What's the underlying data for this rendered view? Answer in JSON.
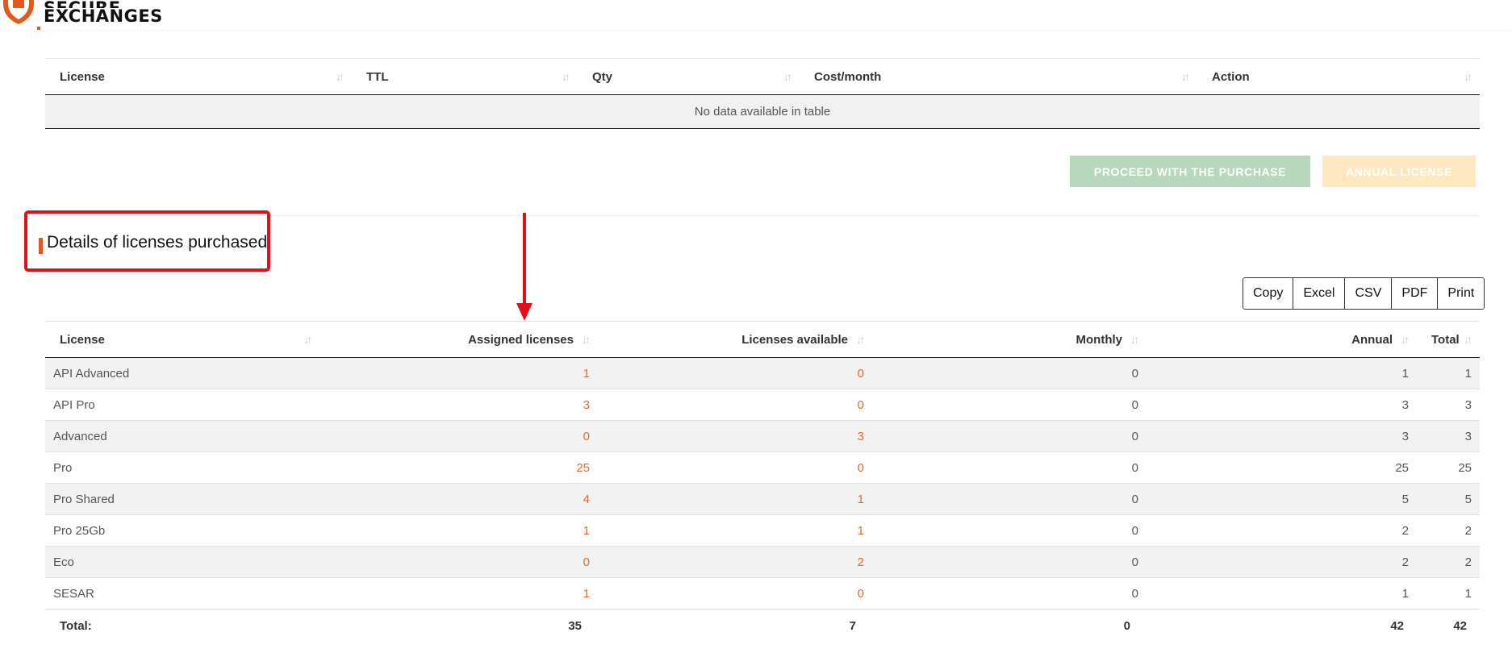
{
  "brand": {
    "line1": "SECURE",
    "line2": "EXCHANGES",
    "accent_color": "#e05a1e"
  },
  "cart_table": {
    "columns": [
      "License",
      "TTL",
      "Qty",
      "Cost/month",
      "Action"
    ],
    "empty_message": "No data available in table"
  },
  "buttons": {
    "purchase": "PROCEED WITH THE PURCHASE",
    "annual": "ANNUAL LICENSE"
  },
  "details": {
    "title": "Details of licenses purchased",
    "export_buttons": [
      "Copy",
      "Excel",
      "CSV",
      "PDF",
      "Print"
    ],
    "columns": [
      "License",
      "Assigned licenses",
      "Licenses available",
      "Monthly",
      "Annual",
      "Total"
    ],
    "rows": [
      {
        "license": "API Advanced",
        "assigned": "1",
        "available": "0",
        "monthly": "0",
        "annual": "1",
        "total": "1"
      },
      {
        "license": "API Pro",
        "assigned": "3",
        "available": "0",
        "monthly": "0",
        "annual": "3",
        "total": "3"
      },
      {
        "license": "Advanced",
        "assigned": "0",
        "available": "3",
        "monthly": "0",
        "annual": "3",
        "total": "3"
      },
      {
        "license": "Pro",
        "assigned": "25",
        "available": "0",
        "monthly": "0",
        "annual": "25",
        "total": "25"
      },
      {
        "license": "Pro Shared",
        "assigned": "4",
        "available": "1",
        "monthly": "0",
        "annual": "5",
        "total": "5"
      },
      {
        "license": "Pro 25Gb",
        "assigned": "1",
        "available": "1",
        "monthly": "0",
        "annual": "2",
        "total": "2"
      },
      {
        "license": "Eco",
        "assigned": "0",
        "available": "2",
        "monthly": "0",
        "annual": "2",
        "total": "2"
      },
      {
        "license": "SESAR",
        "assigned": "1",
        "available": "0",
        "monthly": "0",
        "annual": "1",
        "total": "1"
      }
    ],
    "totals": {
      "label": "Total:",
      "assigned": "35",
      "available": "7",
      "monthly": "0",
      "annual": "42",
      "total": "42"
    }
  },
  "colors": {
    "highlight_red": "#e0101a",
    "value_orange": "#e06a2c",
    "purchase_green": "#b8d8bd",
    "annual_yellow": "#fde8c2"
  }
}
